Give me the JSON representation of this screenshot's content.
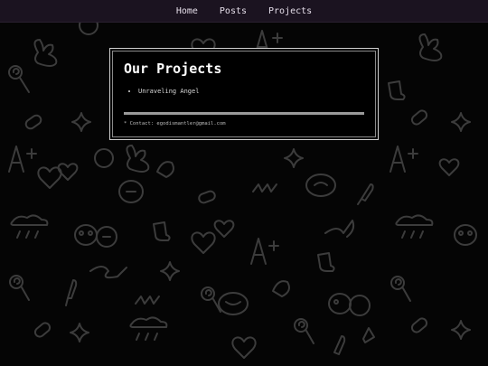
{
  "nav": {
    "items": [
      {
        "label": "Home"
      },
      {
        "label": "Posts"
      },
      {
        "label": "Projects"
      }
    ]
  },
  "main": {
    "title": "Our Projects",
    "projects": [
      {
        "label": "Unraveling Angel"
      }
    ],
    "contact": "* Contact: egodismantler@gmail.com"
  },
  "theme": {
    "background": "#050505",
    "nav_background": "#1b1320",
    "doodle_stroke": "#3c3c3c",
    "panel_border": "#cfcfcf"
  },
  "background_icons": [
    "heart-icon",
    "star-icon",
    "a-plus-icon",
    "lollipop-icon",
    "rain-cloud-icon",
    "bunny-icon",
    "boot-icon",
    "pill-icon",
    "knife-icon",
    "face-icon"
  ]
}
